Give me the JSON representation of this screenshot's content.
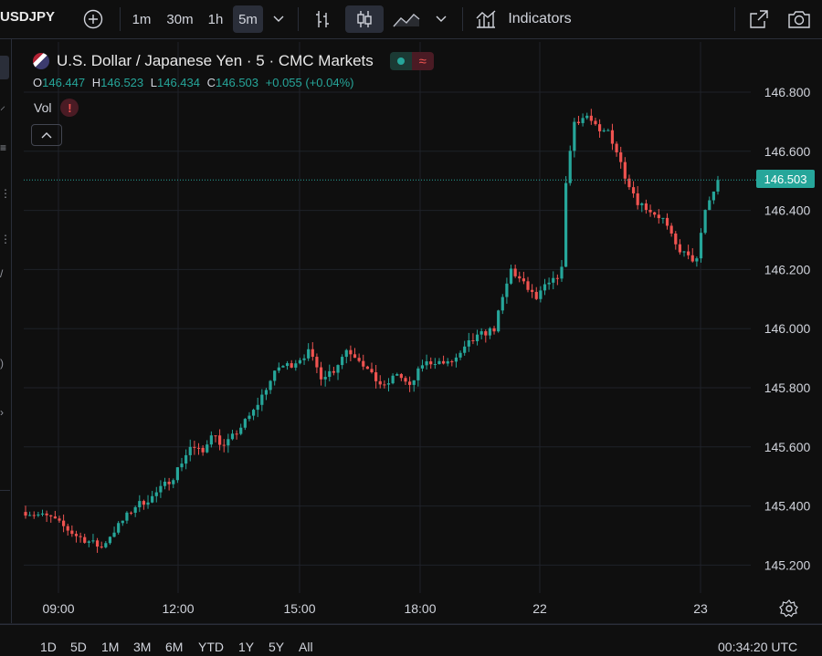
{
  "toolbar": {
    "symbol": "USDJPY",
    "intervals": [
      "1m",
      "30m",
      "1h",
      "5m"
    ],
    "active_interval": "5m",
    "indicators_label": "Indicators"
  },
  "legend": {
    "title": "U.S. Dollar / Japanese Yen · 5 · CMC Markets",
    "o_label": "O",
    "o_value": "146.447",
    "h_label": "H",
    "h_value": "146.523",
    "l_label": "L",
    "l_value": "146.434",
    "c_label": "C",
    "c_value": "146.503",
    "change": "+0.055 (+0.04%)",
    "vol_label": "Vol",
    "warn_symbol": "!"
  },
  "price_badge": "146.503",
  "bottom": {
    "ranges": [
      "1D",
      "5D",
      "1M",
      "3M",
      "6M",
      "YTD",
      "1Y",
      "5Y",
      "All"
    ],
    "clock": "00:34:20 UTC"
  },
  "colors": {
    "up": "#26a69a",
    "down": "#ef5350",
    "bg": "#0f0f0f",
    "grid": "#1f2229"
  },
  "chart_data": {
    "type": "candlestick",
    "title": "U.S. Dollar / Japanese Yen · 5 · CMC Markets",
    "ylim": [
      145.1,
      146.9
    ],
    "y_ticks": [
      145.2,
      145.4,
      145.6,
      145.8,
      146.0,
      146.2,
      146.4,
      146.6,
      146.8
    ],
    "y_tick_labels": [
      "145.200",
      "145.400",
      "145.600",
      "145.800",
      "146.000",
      "146.200",
      "146.400",
      "146.600",
      "146.800"
    ],
    "x_tick_labels": [
      "09:00",
      "12:00",
      "15:00",
      "18:00",
      "22",
      "23"
    ],
    "last_price": 146.503,
    "path_points": [
      [
        0,
        145.38
      ],
      [
        6,
        145.36
      ],
      [
        12,
        145.3
      ],
      [
        18,
        145.26
      ],
      [
        20,
        145.3
      ],
      [
        26,
        145.4
      ],
      [
        30,
        145.43
      ],
      [
        35,
        145.5
      ],
      [
        39,
        145.6
      ],
      [
        42,
        145.58
      ],
      [
        44,
        145.65
      ],
      [
        47,
        145.6
      ],
      [
        50,
        145.65
      ],
      [
        54,
        145.72
      ],
      [
        57,
        145.8
      ],
      [
        60,
        145.87
      ],
      [
        63,
        145.88
      ],
      [
        67,
        145.92
      ],
      [
        70,
        145.84
      ],
      [
        73,
        145.86
      ],
      [
        76,
        145.93
      ],
      [
        79,
        145.9
      ],
      [
        82,
        145.84
      ],
      [
        85,
        145.8
      ],
      [
        88,
        145.85
      ],
      [
        91,
        145.8
      ],
      [
        94,
        145.88
      ],
      [
        97,
        145.89
      ],
      [
        100,
        145.88
      ],
      [
        103,
        145.91
      ],
      [
        105,
        145.95
      ],
      [
        108,
        145.98
      ],
      [
        111,
        146.0
      ],
      [
        113,
        146.1
      ],
      [
        115,
        146.2
      ],
      [
        118,
        146.15
      ],
      [
        121,
        146.1
      ],
      [
        123,
        146.14
      ],
      [
        125,
        146.16
      ],
      [
        127,
        146.2
      ],
      [
        128,
        146.5
      ],
      [
        130,
        146.7
      ],
      [
        133,
        146.72
      ],
      [
        136,
        146.66
      ],
      [
        138,
        146.67
      ],
      [
        140,
        146.6
      ],
      [
        142,
        146.52
      ],
      [
        145,
        146.43
      ],
      [
        148,
        146.4
      ],
      [
        151,
        146.37
      ],
      [
        154,
        146.28
      ],
      [
        157,
        146.24
      ],
      [
        159,
        146.23
      ],
      [
        161,
        146.4
      ],
      [
        164,
        146.5
      ]
    ]
  }
}
